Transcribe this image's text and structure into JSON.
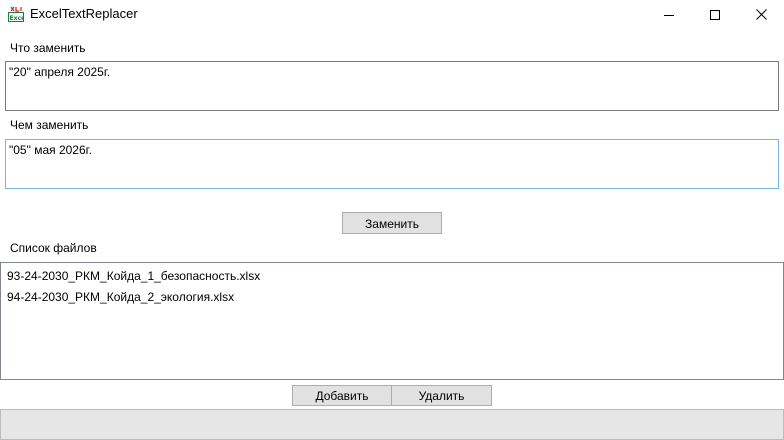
{
  "window": {
    "title": "ExcelTextReplacer",
    "app_icon": "excel-replace-icon",
    "controls": [
      "minimize-icon",
      "maximize-icon",
      "close-icon"
    ]
  },
  "find": {
    "label": "Что заменить",
    "value": "\"20\" апреля 2025г."
  },
  "replace": {
    "label": "Чем заменить",
    "value": "\"05\" мая 2026г."
  },
  "replace_button": {
    "label": "Заменить"
  },
  "files": {
    "label": "Список файлов",
    "items": [
      "93-24-2030_РКМ_Койда_1_безопасность.xlsx",
      "94-24-2030_РКМ_Койда_2_экология.xlsx"
    ]
  },
  "file_actions": {
    "add_label": "Добавить",
    "remove_label": "Удалить"
  },
  "colors": {
    "button_bg": "#e1e1e1",
    "focus_border": "#7eb4ea",
    "status_bg": "#e6e6e6"
  }
}
